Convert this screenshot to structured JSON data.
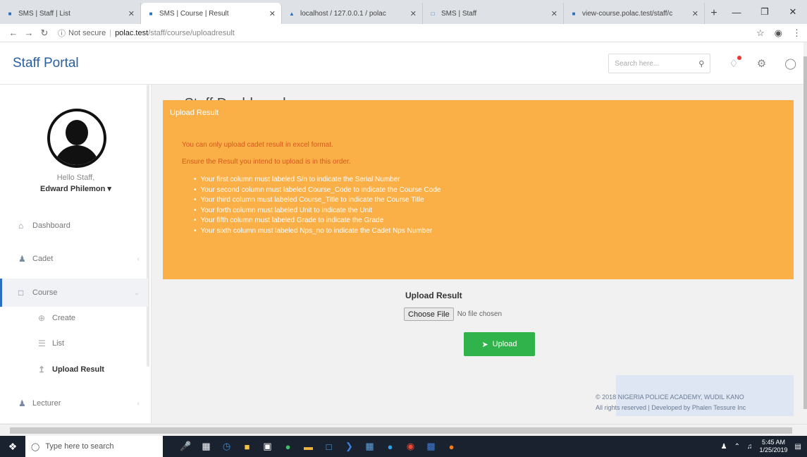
{
  "browser": {
    "tabs": [
      {
        "title": "SMS | Staff | List",
        "active": false
      },
      {
        "title": "SMS | Course | Result",
        "active": true
      },
      {
        "title": "localhost / 127.0.0.1 / polac",
        "active": false
      },
      {
        "title": "SMS | Staff",
        "active": false
      },
      {
        "title": "view-course.polac.test/staff/c",
        "active": false
      }
    ],
    "address": {
      "security": "Not secure",
      "host": "polac.test",
      "path": "/staff/course/uploadresult"
    }
  },
  "header": {
    "brand": "Staff Portal",
    "search_placeholder": "Search here..."
  },
  "sidebar": {
    "greeting": "Hello Staff,",
    "user_name": "Edward Philemon",
    "items": [
      {
        "label": "Dashboard"
      },
      {
        "label": "Cadet"
      },
      {
        "label": "Course"
      },
      {
        "label": "Lecturer"
      }
    ],
    "course_sub": [
      {
        "label": "Create"
      },
      {
        "label": "List"
      },
      {
        "label": "Upload Result"
      }
    ]
  },
  "main": {
    "page_title": "Staff Dashboard",
    "panel": {
      "heading": "Upload Result",
      "line1": "You can only upload cadet result in excel format.",
      "line2": "Ensure the Result you intend to upload is in this order.",
      "rules": [
        "Your first column must labeled S/n to indicate the Serial Number",
        "Your second column must labeled Course_Code to indicate the Course Code",
        "Your third column must labeled Course_Title to indicate the Course Title",
        "Your forth column must labeled Unit to indicate the Unit",
        "Your fifth column must labeled Grade to indicate the Grade",
        "Your sixth column must labeled Nps_no to indicate the Cadet Nps Number"
      ]
    },
    "upload_label": "Upload Result",
    "choose_file": "Choose File",
    "no_file": "No file chosen",
    "upload_button": "Upload"
  },
  "footer": {
    "line1": "© 2018 NIGERIA POLICE ACADEMY, WUDIL KANO",
    "line2": "All rights reserved | Developed by Phalen Tessure Inc"
  },
  "taskbar": {
    "search_placeholder": "Type here to search",
    "time": "5:45 AM",
    "date": "1/25/2019"
  }
}
